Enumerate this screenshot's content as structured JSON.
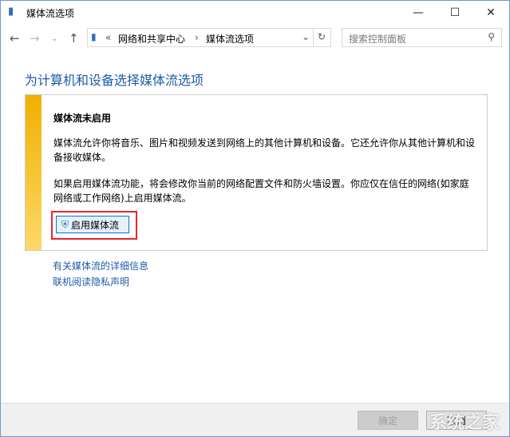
{
  "window": {
    "title": "媒体流选项",
    "icon": "media-streaming-icon"
  },
  "nav": {
    "breadcrumb": [
      "网络和共享中心",
      "媒体流选项"
    ],
    "overflow": "«",
    "search_placeholder": "搜索控制面板"
  },
  "main": {
    "heading": "为计算机和设备选择媒体流选项",
    "panel": {
      "title": "媒体流未启用",
      "para1": "媒体流允许你将音乐、图片和视频发送到网络上的其他计算机和设备。它还允许你从其他计算机和设备接收媒体。",
      "para2": "如果启用媒体流功能，将会修改你当前的网络配置文件和防火墙设置。你应仅在信任的网络(如家庭网络或工作网络)上启用媒体流。",
      "enable_button": "启用媒体流"
    },
    "links": [
      "有关媒体流的详细信息",
      "联机阅读隐私声明"
    ]
  },
  "footer": {
    "ok": "确定",
    "cancel": "取消",
    "watermark": "系统之家"
  },
  "colors": {
    "accent": "#1e5aa8",
    "highlight": "#e8262b",
    "strip": "#f1b000"
  }
}
